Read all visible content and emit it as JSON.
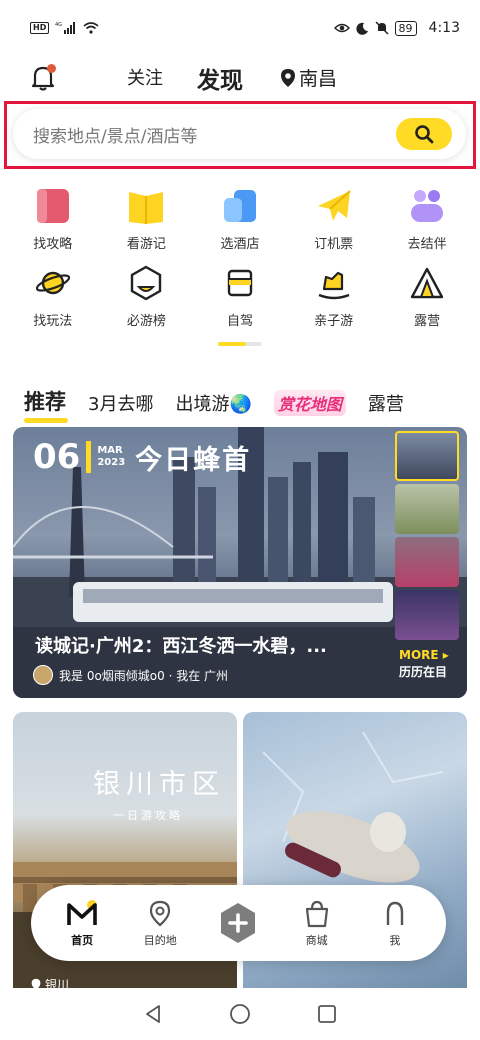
{
  "status_bar": {
    "network": "4G",
    "battery": "89",
    "time": "4:13",
    "hd": "HD"
  },
  "top_nav": {
    "follow": "关注",
    "discover": "发现",
    "city": "南昌"
  },
  "search": {
    "placeholder": "搜索地点/景点/酒店等"
  },
  "grid": {
    "row1": [
      {
        "label": "找攻略",
        "icon": "guide-book-icon",
        "color": "#e45a6e"
      },
      {
        "label": "看游记",
        "icon": "travel-notes-icon",
        "color": "#ffd321"
      },
      {
        "label": "选酒店",
        "icon": "hotel-icon",
        "color": "#4a9af5"
      },
      {
        "label": "订机票",
        "icon": "plane-icon",
        "color": "#ffd321"
      },
      {
        "label": "去结伴",
        "icon": "companions-icon",
        "color": "#9a7cf0"
      }
    ],
    "row2": [
      {
        "label": "找玩法",
        "icon": "planet-icon"
      },
      {
        "label": "必游榜",
        "icon": "ranking-icon"
      },
      {
        "label": "自驾",
        "icon": "car-icon"
      },
      {
        "label": "亲子游",
        "icon": "rocking-horse-icon"
      },
      {
        "label": "露营",
        "icon": "tent-icon"
      }
    ]
  },
  "categories": {
    "recommend": "推荐",
    "march": "3月去哪",
    "abroad": "出境游🌏",
    "flowers": "赏花地图",
    "camping": "露营"
  },
  "featured": {
    "day": "06",
    "month": "MAR",
    "year": "2023",
    "daily": "今日蜂首",
    "title": "读城记·广州2：西江冬洒一水碧，...",
    "author": "我是 0o烟雨倾城o0 · 我在 广州",
    "more": "MORE ▸",
    "more_sub": "历历在目"
  },
  "cards": {
    "left_title": "银川市区",
    "left_subtitle": "一日游攻略",
    "left_location": "银川"
  },
  "bottom_nav": {
    "home": "首页",
    "destination": "目的地",
    "shop": "商城",
    "me": "我"
  },
  "colors": {
    "accent": "#ffdb26",
    "highlight_frame": "#e3153f"
  }
}
